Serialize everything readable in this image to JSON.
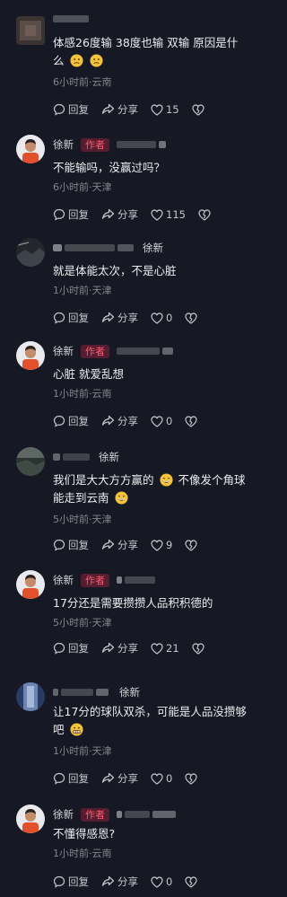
{
  "labels": {
    "reply": "回复",
    "share": "分享",
    "author_badge": "作者"
  },
  "comments": [
    {
      "username": "",
      "is_author": false,
      "text": "体感26度输 38度也输 双输  原因是什么",
      "emojis_after": 2,
      "meta": "6小时前·云南",
      "likes": "15"
    },
    {
      "username": "徐新",
      "is_author": true,
      "text": "不能输吗，没赢过吗？",
      "meta": "6小时前·天津",
      "likes": "115"
    },
    {
      "username": "徐新",
      "is_author": false,
      "text": "就是体能太次，不是心脏",
      "meta": "1小时前·天津",
      "likes": "0"
    },
    {
      "username": "徐新",
      "is_author": true,
      "text": "心脏 就爱乱想",
      "meta": "1小时前·云南",
      "likes": "0"
    },
    {
      "username": "徐新",
      "is_author": false,
      "text_parts": [
        "我们是大大方方赢的",
        " 不像发个角球能走到云南"
      ],
      "meta": "5小时前·天津",
      "likes": "9"
    },
    {
      "username": "徐新",
      "is_author": true,
      "text": "17分还是需要攒攒人品积积德的",
      "meta": "5小时前·天津",
      "likes": "21"
    },
    {
      "username": "徐新",
      "is_author": false,
      "text": "让17分的球队双杀，可能是人品没攒够吧",
      "meta": "1小时前·天津",
      "likes": "0"
    },
    {
      "username": "徐新",
      "is_author": true,
      "text": "不懂得感恩?",
      "meta": "1小时前·云南",
      "likes": "0"
    }
  ]
}
